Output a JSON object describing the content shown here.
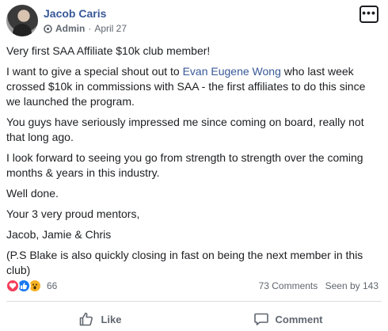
{
  "post": {
    "author": "Jacob Caris",
    "role": "Admin",
    "date": "April 27",
    "separator": "·",
    "more_label": "•••",
    "paragraphs": {
      "p1": "Very first SAA Affiliate $10k club member!",
      "p2_before": "I want to give a special shout out to ",
      "p2_mention": "Evan Eugene Wong",
      "p2_after": " who last week crossed $10k in commissions with SAA - the first affiliates to do this since we launched the program.",
      "p3": "You guys have seriously impressed me since coming on board, really not that long ago.",
      "p4": "I look forward to seeing you go from strength to strength over the coming months & years in this industry.",
      "p5": "Well done.",
      "p6": "Your 3 very proud mentors,",
      "p7": "Jacob, Jamie & Chris",
      "p8": "(P.S Blake is also quickly closing in fast on being the next member in this club)"
    },
    "mention_color": "#385898"
  },
  "reactions": {
    "icons": [
      "love-icon",
      "like-icon",
      "wow-icon"
    ],
    "count": "66"
  },
  "stats": {
    "comments": "73 Comments",
    "seen": "Seen by 143"
  },
  "actions": {
    "like_label": "Like",
    "comment_label": "Comment"
  },
  "colors": {
    "link": "#385898",
    "secondary_text": "#606770",
    "love": "#f33e58",
    "like": "#1877f2",
    "wow": "#f7b125"
  }
}
